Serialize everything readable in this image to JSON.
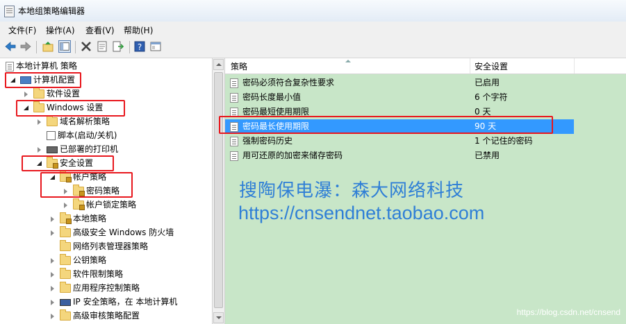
{
  "window": {
    "title": "本地组策略编辑器"
  },
  "menu": [
    "文件(F)",
    "操作(A)",
    "查看(V)",
    "帮助(H)"
  ],
  "toolbar_icons": [
    "back-arrow-icon",
    "forward-arrow-icon",
    "up-folder-icon",
    "show-hide-tree-icon",
    "delete-icon",
    "properties-icon",
    "export-list-icon",
    "help-icon",
    "console-icon"
  ],
  "tree": [
    {
      "label": "本地计算机 策略",
      "icon": "doc-icon",
      "toggle": "none",
      "level": 0
    },
    {
      "label": "计算机配置",
      "icon": "computer-icon",
      "toggle": "expanded",
      "level": 0
    },
    {
      "label": "软件设置",
      "icon": "folder-icon",
      "toggle": "collapsed",
      "level": 1
    },
    {
      "label": "Windows 设置",
      "icon": "folder-icon",
      "toggle": "expanded",
      "level": 1
    },
    {
      "label": "域名解析策略",
      "icon": "folder-icon",
      "toggle": "collapsed",
      "level": 2
    },
    {
      "label": "脚本(启动/关机)",
      "icon": "script-icon",
      "toggle": "none",
      "level": 2
    },
    {
      "label": "已部署的打印机",
      "icon": "printer-icon",
      "toggle": "collapsed",
      "level": 2
    },
    {
      "label": "安全设置",
      "icon": "security-folder-icon",
      "toggle": "expanded",
      "level": 2
    },
    {
      "label": "帐户策略",
      "icon": "security-folder-icon",
      "toggle": "expanded",
      "level": 3
    },
    {
      "label": "密码策略",
      "icon": "security-folder-icon",
      "toggle": "collapsed",
      "level": 4
    },
    {
      "label": "帐户锁定策略",
      "icon": "security-folder-icon",
      "toggle": "collapsed",
      "level": 4
    },
    {
      "label": "本地策略",
      "icon": "security-folder-icon",
      "toggle": "collapsed",
      "level": 3
    },
    {
      "label": "高级安全 Windows 防火墙",
      "icon": "folder-icon",
      "toggle": "collapsed",
      "level": 3
    },
    {
      "label": "网络列表管理器策略",
      "icon": "folder-icon",
      "toggle": "none",
      "level": 3
    },
    {
      "label": "公钥策略",
      "icon": "folder-icon",
      "toggle": "collapsed",
      "level": 3
    },
    {
      "label": "软件限制策略",
      "icon": "folder-icon",
      "toggle": "collapsed",
      "level": 3
    },
    {
      "label": "应用程序控制策略",
      "icon": "folder-icon",
      "toggle": "collapsed",
      "level": 3
    },
    {
      "label": "IP 安全策略，在 本地计算机",
      "icon": "ip-security-icon",
      "toggle": "collapsed",
      "level": 3
    },
    {
      "label": "高级审核策略配置",
      "icon": "folder-icon",
      "toggle": "collapsed",
      "level": 3
    }
  ],
  "list": {
    "columns": [
      "策略",
      "安全设置"
    ],
    "rows": [
      {
        "policy": "密码必须符合复杂性要求",
        "setting": "已启用",
        "selected": false
      },
      {
        "policy": "密码长度最小值",
        "setting": "6 个字符",
        "selected": false
      },
      {
        "policy": "密码最短使用期限",
        "setting": "0 天",
        "selected": false
      },
      {
        "policy": "密码最长使用期限",
        "setting": "90 天",
        "selected": true
      },
      {
        "policy": "强制密码历史",
        "setting": "1 个记住的密码",
        "selected": false
      },
      {
        "policy": "用可还原的加密来储存密码",
        "setting": "已禁用",
        "selected": false
      }
    ]
  },
  "overlay": {
    "line1": "搜陶保电瀑：森大网络科技",
    "line2": "https://cnsendnet.taobao.com",
    "credit": "https://blog.csdn.net/cnsend"
  },
  "colors": {
    "selection": "#3399ff",
    "highlight_box": "#e8171d",
    "list_bg": "#c8e6c8",
    "overlay_text": "#2f7fd6"
  }
}
